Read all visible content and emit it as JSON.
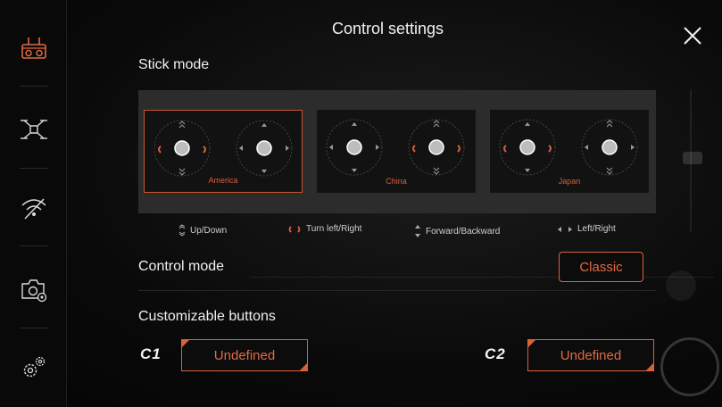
{
  "dialog": {
    "title": "Control settings"
  },
  "sidebar": {
    "items": [
      {
        "icon": "remote-controller-icon",
        "active": true
      },
      {
        "icon": "drone-icon"
      },
      {
        "icon": "signal-icon"
      },
      {
        "icon": "camera-settings-icon"
      },
      {
        "icon": "general-settings-icon"
      }
    ]
  },
  "stick_mode": {
    "label": "Stick mode",
    "selected": "America",
    "modes": [
      {
        "name": "America"
      },
      {
        "name": "China"
      },
      {
        "name": "Japan"
      }
    ],
    "legend": {
      "updown": "Up/Down",
      "turn": "Turn left/Right",
      "forward": "Forward/Backward",
      "leftright": "Left/Right"
    }
  },
  "control_mode": {
    "label": "Control mode",
    "value": "Classic"
  },
  "custom_buttons": {
    "label": "Customizable buttons",
    "c1": {
      "key": "C1",
      "value": "Undefined"
    },
    "c2": {
      "key": "C2",
      "value": "Undefined"
    }
  },
  "colors": {
    "accent": "#d9613a",
    "panel": "#2c2c2c",
    "card": "#121212"
  }
}
